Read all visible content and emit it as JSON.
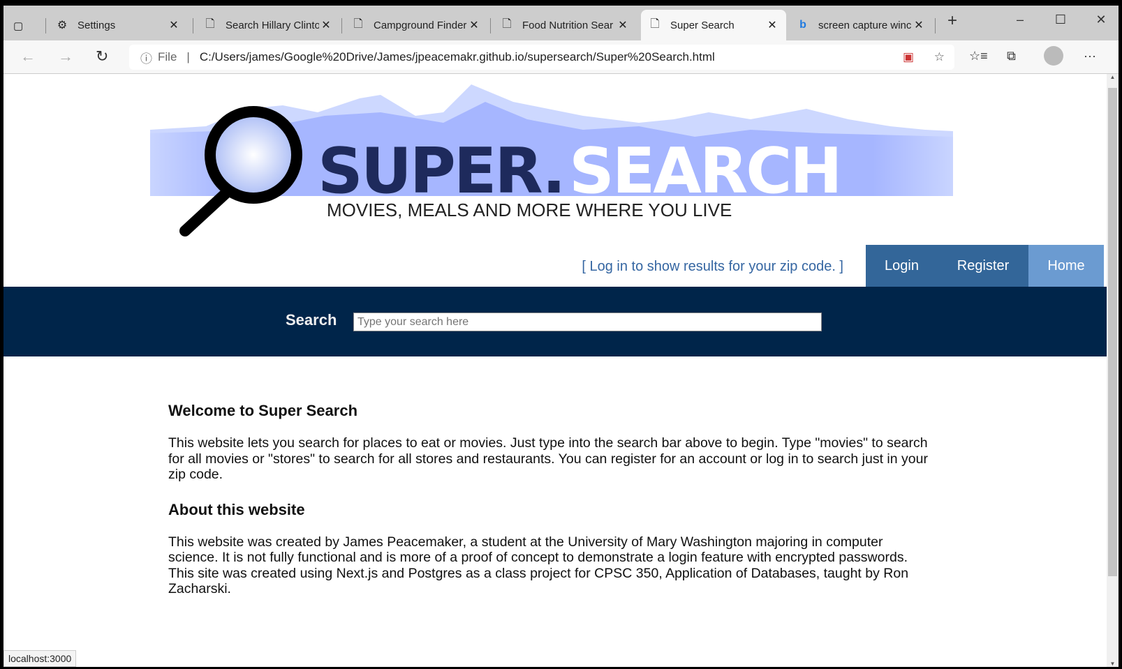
{
  "browser": {
    "tabs": [
      {
        "label": "Settings",
        "icon": "gear-icon"
      },
      {
        "label": "Search Hillary Clinto",
        "icon": "page-icon"
      },
      {
        "label": "Campground Finder",
        "icon": "page-icon"
      },
      {
        "label": "Food Nutrition Sear",
        "icon": "page-icon"
      },
      {
        "label": "Super Search",
        "icon": "page-icon",
        "active": true
      },
      {
        "label": "screen capture winc",
        "icon": "bing-icon"
      }
    ],
    "close_glyph": "✕",
    "new_tab": "+",
    "file_label": "File",
    "url": "C:/Users/james/Google%20Drive/James/jpeacemakr.github.io/supersearch/Super%20Search.html",
    "status_url": "localhost:3000"
  },
  "page": {
    "logo": {
      "word1": "SUPER.",
      "word2": "SEARCH",
      "tagline": "MOVIES, MEALS AND MORE WHERE YOU LIVE"
    },
    "login_message": "[ Log in to show results for your zip code. ]",
    "nav": {
      "login": "Login",
      "register": "Register",
      "home": "Home"
    },
    "colors": {
      "nav": "#336699",
      "home": "#6b9bd1",
      "band": "#00254a"
    },
    "search": {
      "label": "Search",
      "placeholder": "Type your search here"
    },
    "sections": [
      {
        "heading": "Welcome to Super Search",
        "text": "This website lets you search for places to eat or movies. Just type into the search bar above to begin. Type \"movies\" to search for all movies or \"stores\" to search for all stores and restaurants. You can register for an account or log in to search just in your zip code."
      },
      {
        "heading": "About this website",
        "text": "This website was created by James Peacemaker, a student at the University of Mary Washington majoring in computer science. It is not fully functional and is more of a proof of concept to demonstrate a login feature with encrypted passwords. This site was created using Next.js and Postgres as a class project for CPSC 350, Application of Databases, taught by Ron Zacharski."
      }
    ]
  }
}
